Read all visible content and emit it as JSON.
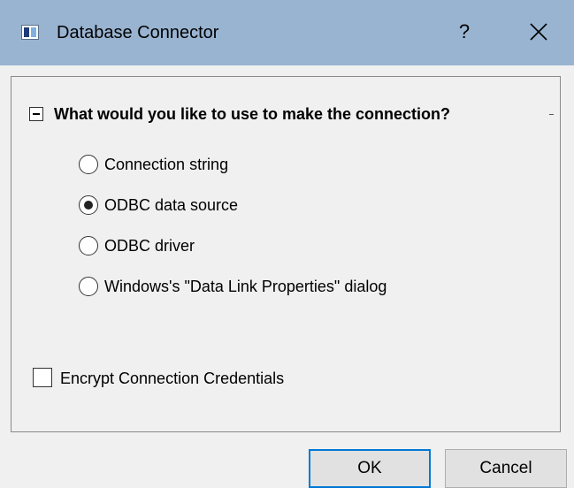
{
  "window": {
    "title": "Database Connector",
    "help_label": "?",
    "accent_color": "#0078d7",
    "titlebar_color": "#99b4d1"
  },
  "group": {
    "title": "What would you like to use to make the connection?",
    "options": [
      {
        "label": "Connection string",
        "checked": false
      },
      {
        "label": "ODBC data source",
        "checked": true
      },
      {
        "label": "ODBC driver",
        "checked": false
      },
      {
        "label": "Windows's \"Data Link Properties\" dialog",
        "checked": false
      }
    ]
  },
  "encrypt": {
    "label": "Encrypt Connection Credentials",
    "checked": false
  },
  "buttons": {
    "ok": "OK",
    "cancel": "Cancel"
  }
}
